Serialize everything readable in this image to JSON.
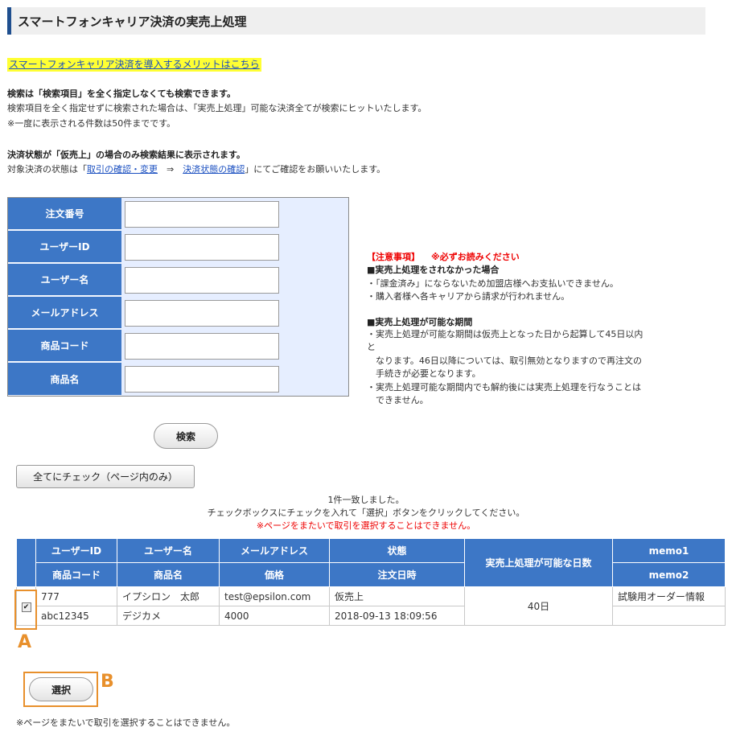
{
  "header": {
    "title": "スマートフォンキャリア決済の実売上処理"
  },
  "merit_link": "スマートフォンキャリア決済を導入するメリットはこちら",
  "info": {
    "line1": "検索は「検索項目」を全く指定しなくても検索できます。",
    "line2": "検索項目を全く指定せずに検索された場合は、「実売上処理」可能な決済全てが検索にヒットいたします。",
    "line3": "※一度に表示される件数は50件までです。",
    "line4": "決済状態が「仮売上」の場合のみ検索結果に表示されます。",
    "line5_a": "対象決済の状態は「",
    "line5_link1": "取引の確認・変更",
    "line5_arrow": "　⇒　",
    "line5_link2": "決済状態の確認",
    "line5_b": "」にてご確認をお願いいたします。"
  },
  "search_form": {
    "fields": [
      {
        "label": "注文番号",
        "value": ""
      },
      {
        "label": "ユーザーID",
        "value": ""
      },
      {
        "label": "ユーザー名",
        "value": ""
      },
      {
        "label": "メールアドレス",
        "value": ""
      },
      {
        "label": "商品コード",
        "value": ""
      },
      {
        "label": "商品名",
        "value": ""
      }
    ],
    "search_button": "検索"
  },
  "notes": {
    "title_a": "【注意事項】",
    "title_b": "※必ずお読みください",
    "s1_title": "■実売上処理をされなかった場合",
    "s1_l1": "・「課金済み」にならないため加盟店様へお支払いできません。",
    "s1_l2": "・購入者様へ各キャリアから請求が行われません。",
    "s2_title": "■実売上処理が可能な期間",
    "s2_l1": "・実売上処理が可能な期間は仮売上となった日から起算して45日以内",
    "s2_l2": "と",
    "s2_l3": "　なります。46日以降については、取引無効となりますので再注文の",
    "s2_l4": "　手続きが必要となります。",
    "s2_l5": "・実売上処理可能な期間内でも解約後には実売上処理を行なうことは",
    "s2_l6": "　できません。"
  },
  "check_all_button": "全てにチェック（ページ内のみ）",
  "result_msg": {
    "count": "1件一致しました。",
    "instruction": "チェックボックスにチェックを入れて「選択」ボタンをクリックしてください。",
    "warning": "※ページをまたいで取引を選択することはできません。"
  },
  "table": {
    "headers_row1": [
      "ユーザーID",
      "ユーザー名",
      "メールアドレス",
      "状態",
      "実売上処理が可能な日数",
      "memo1"
    ],
    "headers_row2": [
      "商品コード",
      "商品名",
      "価格",
      "注文日時",
      "memo2"
    ],
    "rows": [
      {
        "checked": "✔",
        "user_id": "777",
        "user_name": "イプシロン　太郎",
        "email": "test@epsilon.com",
        "status": "仮売上",
        "days": "40日",
        "memo1": "試験用オーダー情報",
        "product_code": "abc12345",
        "product_name": "デジカメ",
        "price": "4000",
        "order_date": "2018-09-13 18:09:56",
        "memo2": ""
      }
    ]
  },
  "annotations": {
    "a": "A",
    "b": "B"
  },
  "select_button": "選択",
  "footer_note": "※ページをまたいで取引を選択することはできません。",
  "colors": {
    "header_blue": "#3d77c6",
    "accent_orange": "#e8902c",
    "highlight": "#ffff33",
    "warning_red": "#ee0000"
  }
}
